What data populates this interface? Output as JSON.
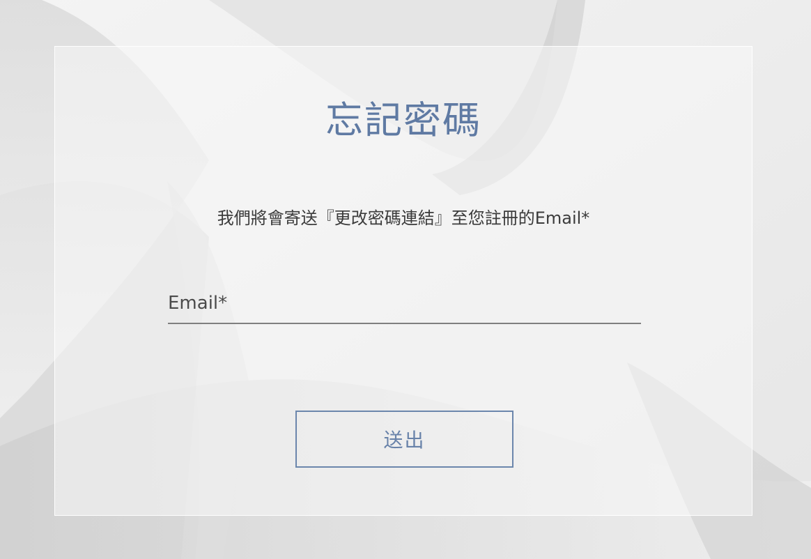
{
  "page": {
    "title": "忘記密碼",
    "description": "我們將會寄送『更改密碼連結』至您註冊的Email*"
  },
  "form": {
    "email_placeholder": "Email*",
    "email_value": "",
    "submit_label": "送出"
  },
  "colors": {
    "accent": "#5f7aa3",
    "button_border": "#6b86ac",
    "underline": "#7f7f7f",
    "text": "#3b3b3b"
  }
}
